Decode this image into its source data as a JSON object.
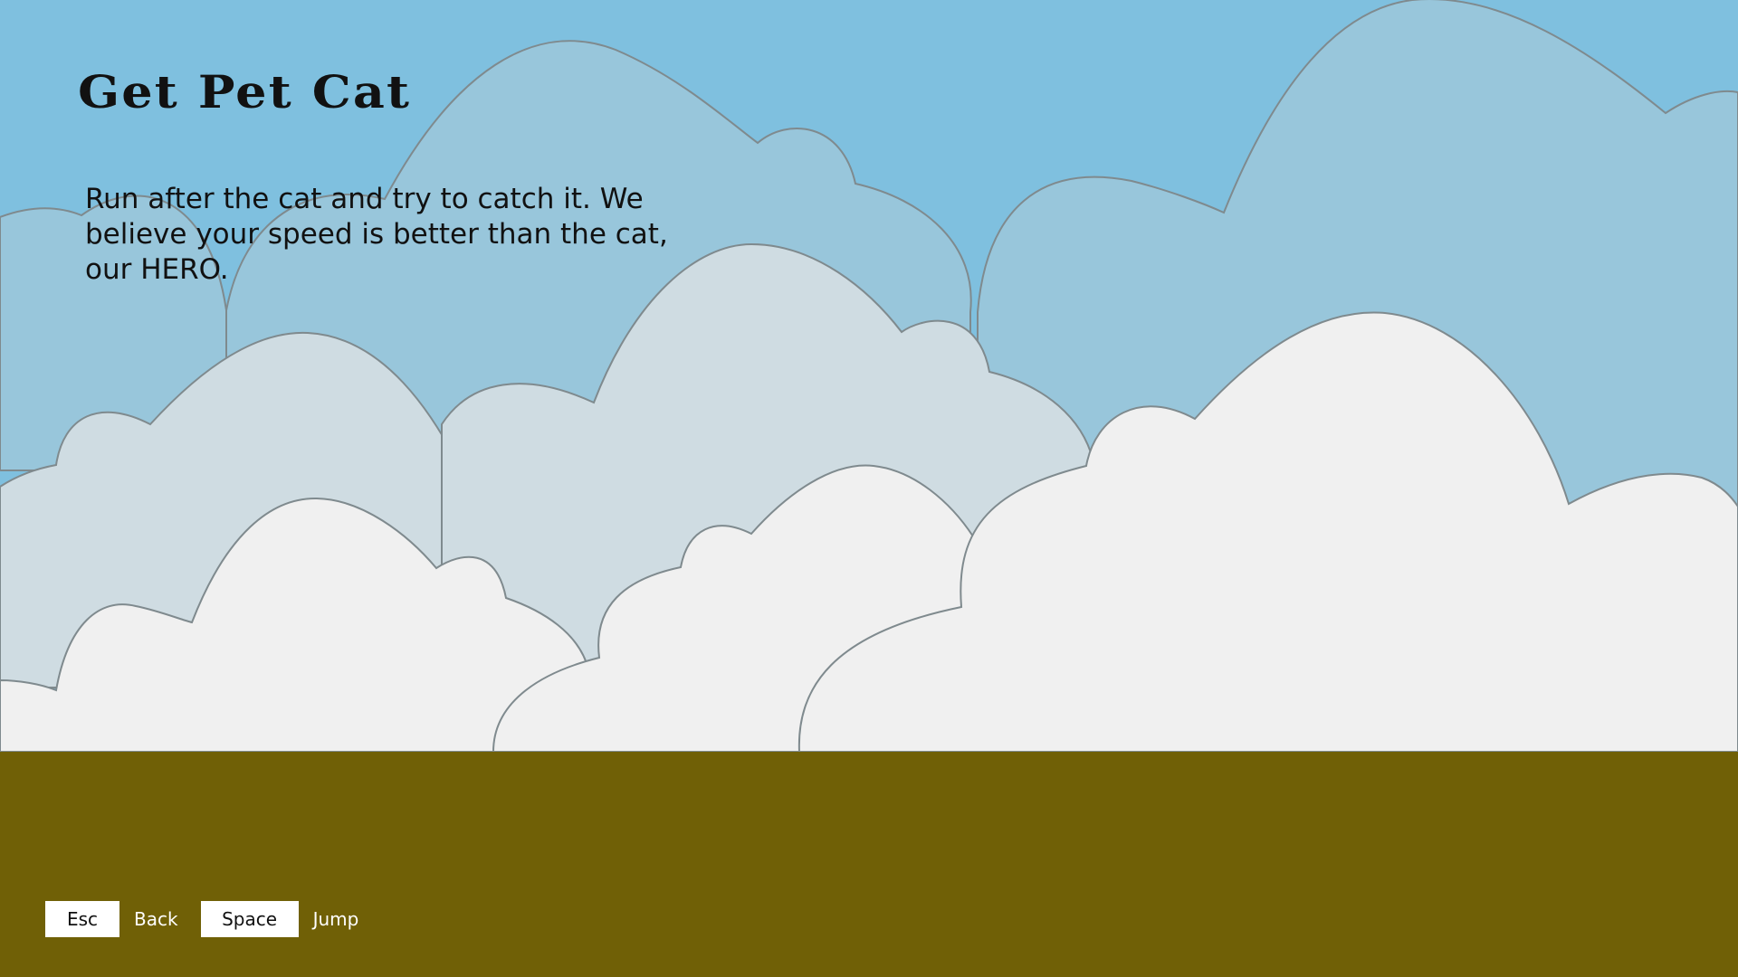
{
  "title": "Get Pet Cat",
  "description": "Run after the cat and try to catch it. We believe your speed is better than the cat, our HERO.",
  "controls": [
    {
      "key": "Esc",
      "action": "Back"
    },
    {
      "key": "Space",
      "action": "Jump"
    }
  ],
  "colors": {
    "sky": "#7fc0df",
    "cloud_back": "#98c6db",
    "cloud_mid": "#cfdce2",
    "cloud_front": "#f0f0f0",
    "cloud_outline": "#7f8a8e",
    "ground": "#706006",
    "key_background": "#ffffff"
  }
}
